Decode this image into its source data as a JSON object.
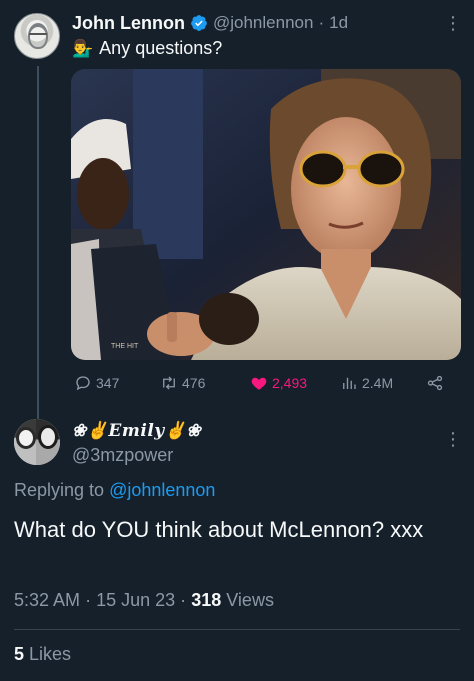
{
  "parent_tweet": {
    "display_name": "John Lennon",
    "handle": "@johnlennon",
    "separator": "·",
    "time": "1d",
    "text": "Any questions?",
    "emoji": "💁‍♂️",
    "stats": {
      "replies": "347",
      "retweets": "476",
      "likes": "2,493",
      "views": "2.4M"
    },
    "photo_caption": "THE HIT"
  },
  "reply_tweet": {
    "display_name": "❀✌𝑬𝒎𝒊𝒍𝒚✌❀",
    "handle": "@3mzpower",
    "replying_prefix": "Replying to",
    "replying_handle": "@johnlennon",
    "text": "What do YOU think about McLennon? xxx",
    "time": "5:32 AM",
    "sep1": "·",
    "date": "15 Jun 23",
    "sep2": "·",
    "views_count": "318",
    "views_label": "Views",
    "likes_count": "5",
    "likes_label": "Likes"
  },
  "colors": {
    "background": "#15202b",
    "secondary_text": "#8b98a5",
    "link": "#1d9bf0",
    "like_pink": "#f91880",
    "verified_blue": "#1d9bf0"
  },
  "icons": [
    "verified-badge-icon",
    "more-icon",
    "reply-icon",
    "retweet-icon",
    "heart-icon",
    "views-icon",
    "share-icon"
  ]
}
